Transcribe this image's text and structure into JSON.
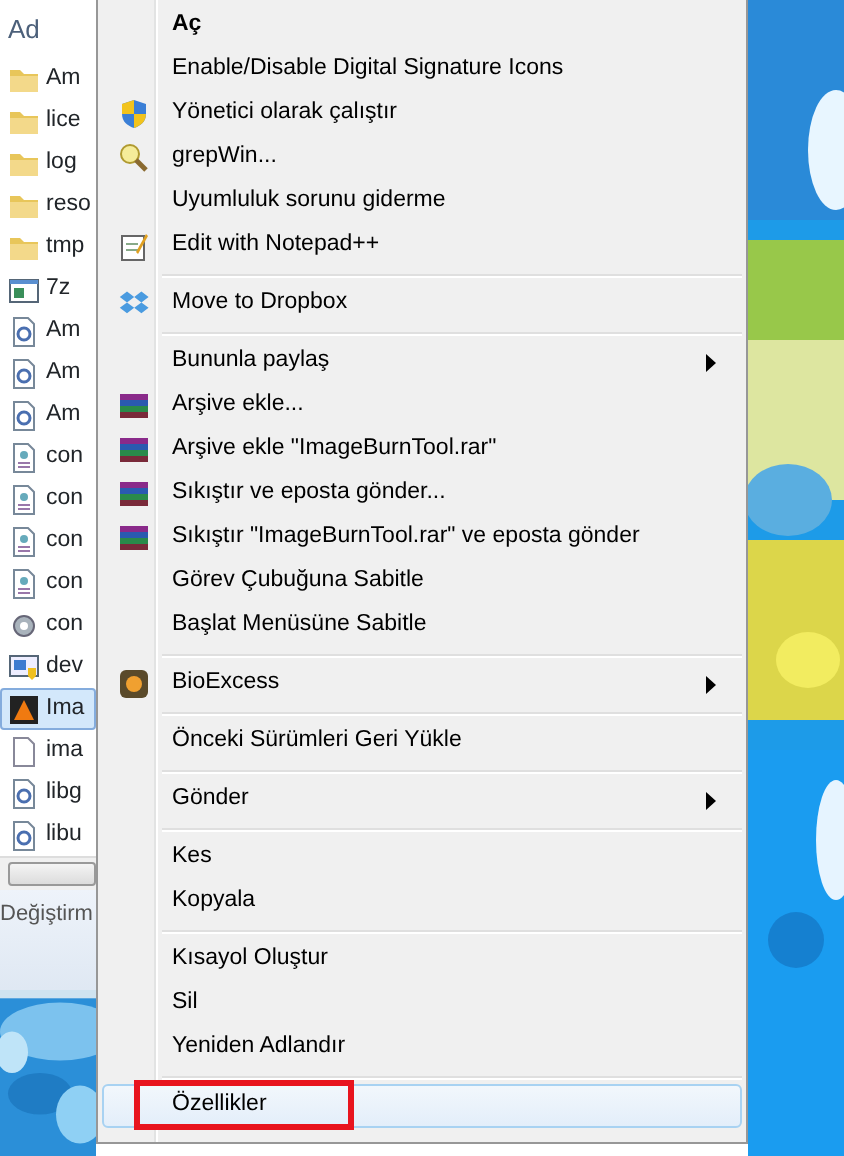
{
  "explorer": {
    "column_header": "Ad",
    "files": [
      {
        "name": "Am",
        "kind": "folder",
        "selected": false
      },
      {
        "name": "lice",
        "kind": "folder",
        "selected": false
      },
      {
        "name": "log",
        "kind": "folder",
        "selected": false
      },
      {
        "name": "reso",
        "kind": "folder",
        "selected": false
      },
      {
        "name": "tmp",
        "kind": "folder",
        "selected": false
      },
      {
        "name": "7z",
        "kind": "window",
        "selected": false
      },
      {
        "name": "Am",
        "kind": "dll",
        "selected": false
      },
      {
        "name": "Am",
        "kind": "dll",
        "selected": false
      },
      {
        "name": "Am",
        "kind": "dll",
        "selected": false
      },
      {
        "name": "con",
        "kind": "config",
        "selected": false
      },
      {
        "name": "con",
        "kind": "config",
        "selected": false
      },
      {
        "name": "con",
        "kind": "config",
        "selected": false
      },
      {
        "name": "con",
        "kind": "config",
        "selected": false
      },
      {
        "name": "con",
        "kind": "gear",
        "selected": false
      },
      {
        "name": "dev",
        "kind": "installer",
        "selected": false
      },
      {
        "name": "Ima",
        "kind": "app",
        "selected": true
      },
      {
        "name": "ima",
        "kind": "blank",
        "selected": false
      },
      {
        "name": "libg",
        "kind": "dll",
        "selected": false
      },
      {
        "name": "libu",
        "kind": "dll",
        "selected": false
      }
    ],
    "status": "Değiştirm"
  },
  "context_menu": {
    "groups": [
      [
        {
          "label": "Aç",
          "default": true,
          "submenu": false,
          "selected": false
        },
        {
          "label": "Enable/Disable Digital Signature Icons",
          "default": false,
          "submenu": false,
          "selected": false
        },
        {
          "label": "Yönetici olarak çalıştır",
          "kind": "shield",
          "default": false,
          "submenu": false,
          "selected": false
        },
        {
          "label": "grepWin...",
          "kind": "magnifier",
          "default": false,
          "submenu": false,
          "selected": false
        },
        {
          "label": "Uyumluluk sorunu giderme",
          "default": false,
          "submenu": false,
          "selected": false
        },
        {
          "label": "Edit with Notepad++",
          "kind": "notepad",
          "default": false,
          "submenu": false,
          "selected": false
        }
      ],
      [
        {
          "label": "Move to Dropbox",
          "kind": "dropbox",
          "default": false,
          "submenu": false,
          "selected": false
        }
      ],
      [
        {
          "label": "Bununla paylaş",
          "default": false,
          "submenu": true,
          "selected": false
        },
        {
          "label": "Arşive ekle...",
          "kind": "archive",
          "default": false,
          "submenu": false,
          "selected": false
        },
        {
          "label": "Arşive ekle \"ImageBurnTool.rar\"",
          "kind": "archive",
          "default": false,
          "submenu": false,
          "selected": false
        },
        {
          "label": "Sıkıştır ve eposta gönder...",
          "kind": "archive",
          "default": false,
          "submenu": false,
          "selected": false
        },
        {
          "label": "Sıkıştır \"ImageBurnTool.rar\" ve eposta gönder",
          "kind": "archive",
          "default": false,
          "submenu": false,
          "selected": false
        },
        {
          "label": "Görev Çubuğuna Sabitle",
          "default": false,
          "submenu": false,
          "selected": false
        },
        {
          "label": "Başlat Menüsüne Sabitle",
          "default": false,
          "submenu": false,
          "selected": false
        }
      ],
      [
        {
          "label": "BioExcess",
          "kind": "bio",
          "default": false,
          "submenu": true,
          "selected": false
        }
      ],
      [
        {
          "label": "Önceki Sürümleri Geri Yükle",
          "default": false,
          "submenu": false,
          "selected": false
        }
      ],
      [
        {
          "label": "Gönder",
          "default": false,
          "submenu": true,
          "selected": false
        }
      ],
      [
        {
          "label": "Kes",
          "default": false,
          "submenu": false,
          "selected": false
        },
        {
          "label": "Kopyala",
          "default": false,
          "submenu": false,
          "selected": false
        }
      ],
      [
        {
          "label": "Kısayol Oluştur",
          "default": false,
          "submenu": false,
          "selected": false
        },
        {
          "label": "Sil",
          "default": false,
          "submenu": false,
          "selected": false
        },
        {
          "label": "Yeniden Adlandır",
          "default": false,
          "submenu": false,
          "selected": false
        }
      ],
      [
        {
          "label": "Özellikler",
          "default": false,
          "submenu": false,
          "selected": true,
          "annotated": true
        }
      ]
    ]
  }
}
